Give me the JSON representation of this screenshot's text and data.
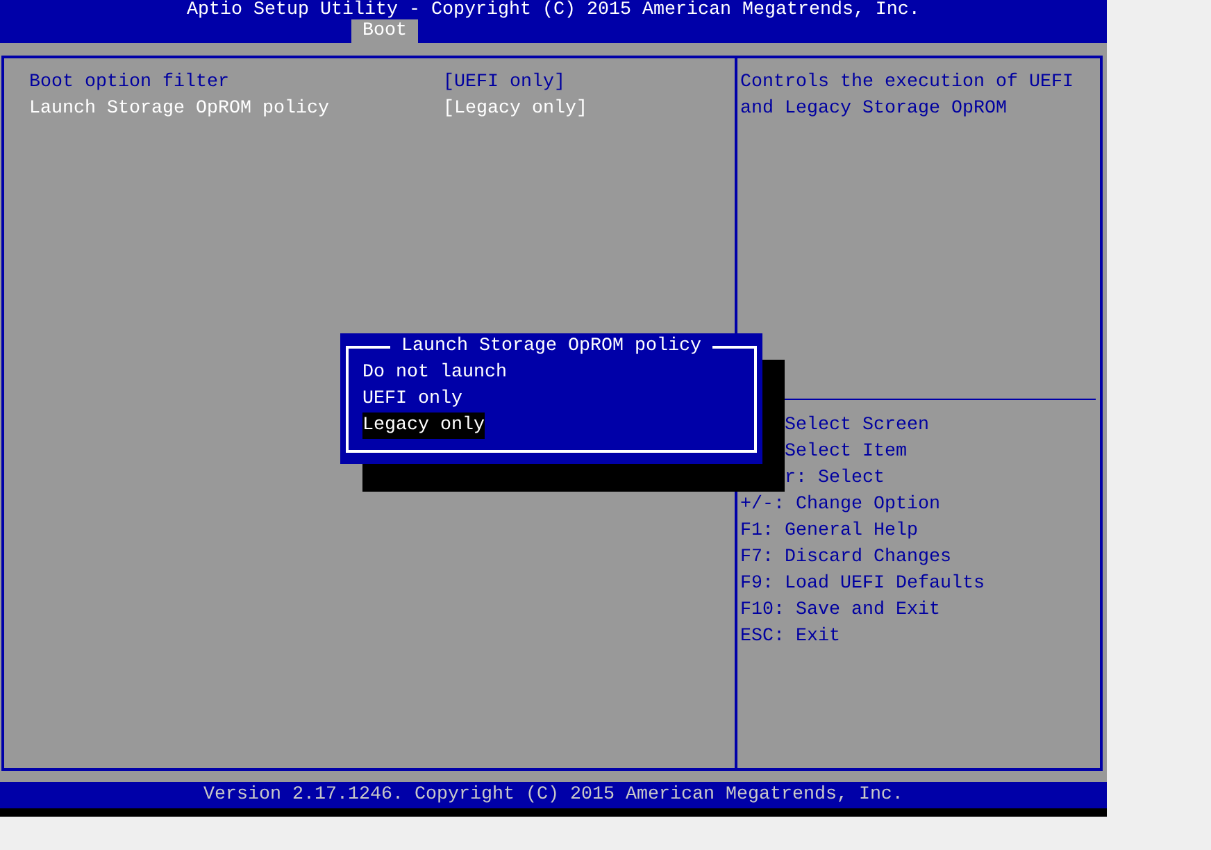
{
  "title": "Aptio Setup Utility - Copyright (C) 2015 American Megatrends, Inc.",
  "tabs": [
    {
      "label": "Boot",
      "selected": true
    }
  ],
  "settings": [
    {
      "label": "Boot option filter",
      "value": "[UEFI only]",
      "selected": false
    },
    {
      "label": "Launch Storage OpROM policy",
      "value": "[Legacy only]",
      "selected": true
    }
  ],
  "help_text": "Controls the execution of UEFI and Legacy Storage OpROM",
  "key_help": [
    {
      "text": "Select Screen",
      "kind": "covered"
    },
    {
      "text": "Select Item",
      "kind": "covered"
    },
    {
      "text": "r: Select",
      "kind": "covered"
    },
    {
      "text": "+/-: Change Option",
      "kind": "plain"
    },
    {
      "text": "F1: General Help",
      "kind": "plain"
    },
    {
      "text": "F7: Discard Changes",
      "kind": "plain"
    },
    {
      "text": "F9: Load UEFI Defaults",
      "kind": "plain"
    },
    {
      "text": "F10: Save and Exit",
      "kind": "plain"
    },
    {
      "text": "ESC: Exit",
      "kind": "plain"
    }
  ],
  "popup": {
    "title": "Launch Storage OpROM policy",
    "options": [
      {
        "label": "Do not launch",
        "selected": false
      },
      {
        "label": "UEFI only",
        "selected": false
      },
      {
        "label": "Legacy only",
        "selected": true
      }
    ]
  },
  "footer": "Version 2.17.1246. Copyright (C) 2015 American Megatrends, Inc."
}
